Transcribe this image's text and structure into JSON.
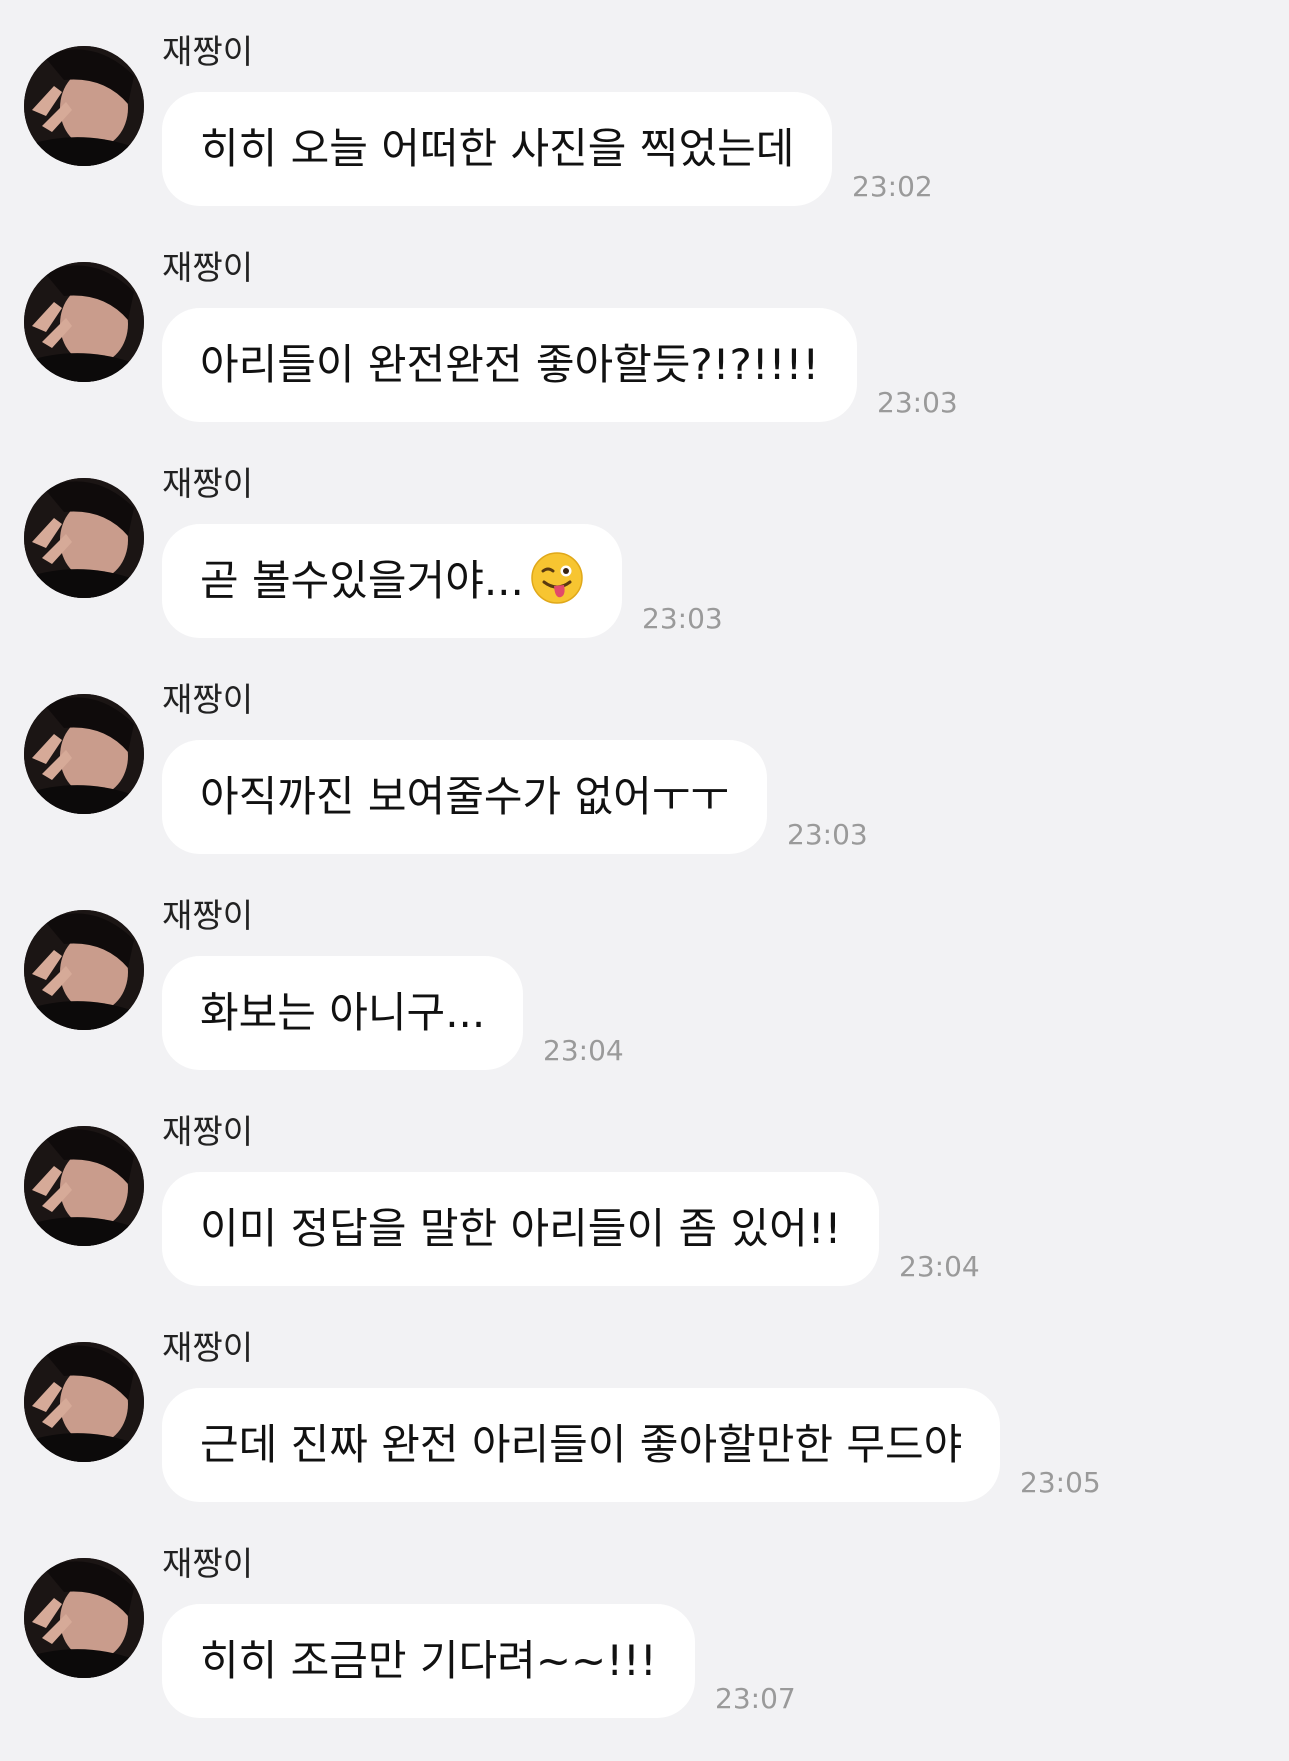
{
  "messages": [
    {
      "sender": "재짱이",
      "text": "히히 오늘 어떠한 사진을 찍었는데",
      "time": "23:02"
    },
    {
      "sender": "재짱이",
      "text": "아리들이 완전완전 좋아할듯?!?!!!!",
      "time": "23:03"
    },
    {
      "sender": "재짱이",
      "text": "곧 볼수있을거야...",
      "time": "23:03",
      "emoji": "winking-face-with-tongue"
    },
    {
      "sender": "재짱이",
      "text": "아직까진 보여줄수가 없어ㅜㅜ",
      "time": "23:03"
    },
    {
      "sender": "재짱이",
      "text": "화보는 아니구...",
      "time": "23:04"
    },
    {
      "sender": "재짱이",
      "text": "이미 정답을 말한 아리들이 좀 있어!!",
      "time": "23:04"
    },
    {
      "sender": "재짱이",
      "text": "근데 진짜 완전 아리들이 좋아할만한 무드야",
      "time": "23:05"
    },
    {
      "sender": "재짱이",
      "text": "히히 조금만 기다려~~!!!",
      "time": "23:07"
    }
  ],
  "colors": {
    "background": "#f2f2f4",
    "bubble": "#ffffff",
    "timestamp": "#9a9a9a"
  }
}
